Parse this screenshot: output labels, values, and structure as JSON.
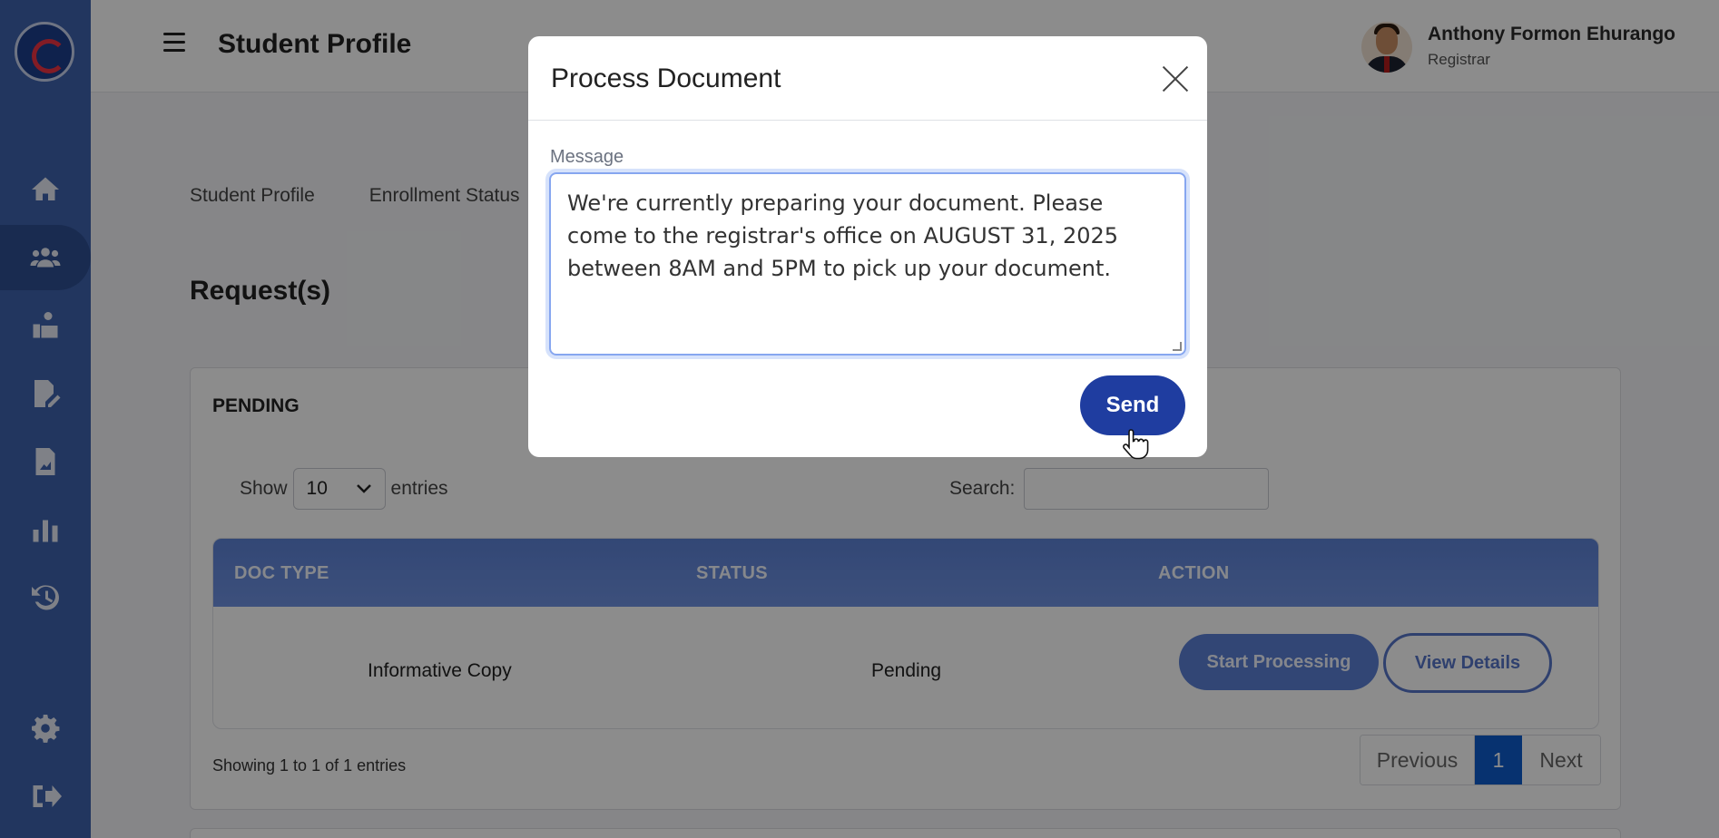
{
  "header": {
    "page_title": "Student Profile",
    "user_name": "Anthony Formon Ehurango",
    "user_role": "Registrar"
  },
  "sidebar": {
    "items": [
      {
        "icon": "home-icon"
      },
      {
        "icon": "users-icon",
        "active": true
      },
      {
        "icon": "reader-icon"
      },
      {
        "icon": "file-edit-icon"
      },
      {
        "icon": "file-image-icon"
      },
      {
        "icon": "bar-chart-icon"
      },
      {
        "icon": "history-icon"
      },
      {
        "icon": "gear-icon"
      },
      {
        "icon": "logout-icon"
      }
    ]
  },
  "tabs": [
    "Student Profile",
    "Enrollment Status"
  ],
  "main": {
    "section_title": "Request(s)",
    "card_title": "PENDING",
    "show_label": "Show",
    "entries_value": "10",
    "entries_label": "entries",
    "search_label": "Search:",
    "table": {
      "columns": [
        "DOC TYPE",
        "STATUS",
        "ACTION"
      ],
      "rows": [
        {
          "doc_type": "Informative Copy",
          "status": "Pending",
          "actions": [
            "Start Processing",
            "View Details"
          ]
        }
      ]
    },
    "showing_text": "Showing 1 to 1 of 1 entries",
    "pagination": {
      "previous": "Previous",
      "current": "1",
      "next": "Next"
    }
  },
  "modal": {
    "title": "Process Document",
    "field_label": "Message",
    "message": "We're currently preparing your document. Please come to the registrar's office on AUGUST 31, 2025 between 8AM and 5PM to pick up your document.",
    "send_label": "Send"
  },
  "colors": {
    "sidebar": "#3f63ae",
    "table_header": "#5d82d6",
    "send_button": "#1f3da0",
    "pagination_active": "#0d5ccc"
  }
}
